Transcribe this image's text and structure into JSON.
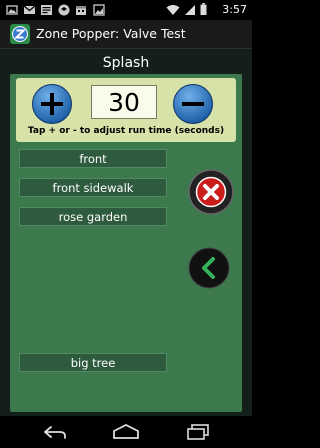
{
  "status_bar": {
    "time": "3:57",
    "icons": [
      "photo-icon",
      "gmail-icon",
      "news-icon",
      "dropbox-icon",
      "calendar-icon",
      "image-icon",
      "wifi-icon",
      "signal-icon",
      "battery-icon"
    ]
  },
  "action_bar": {
    "app_title": "Zone Popper: Valve Test",
    "app_icon": "z-app-icon"
  },
  "header": {
    "title": "Splash"
  },
  "timer": {
    "value": "30",
    "hint": "Tap + or - to adjust run time (seconds)",
    "plus_icon": "plus-icon",
    "minus_icon": "minus-icon"
  },
  "zones": [
    {
      "label": "front"
    },
    {
      "label": "front sidewalk"
    },
    {
      "label": "rose garden"
    },
    {
      "label": "big tree"
    }
  ],
  "nav_bar": {
    "icons": [
      "back-arrow-icon",
      "home-icon",
      "recent-apps-icon"
    ]
  },
  "colors": {
    "panel_green": "#3c7a4e",
    "timer_bg": "#d6e2a8",
    "zone_button": "#2e5a3d",
    "close_red": "#cc1d1d",
    "circle_blue": "#2f73c4"
  }
}
